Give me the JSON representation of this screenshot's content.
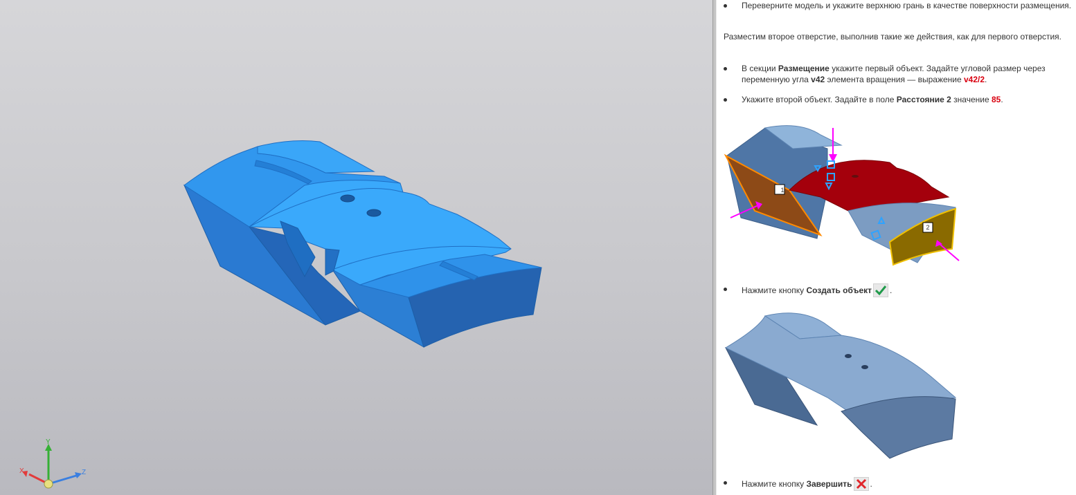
{
  "help": {
    "item1": "Переверните модель и укажите верхнюю грань в качестве поверхности размещения.",
    "para1": "Разместим второе отверстие, выполнив такие же действия, как для первого отверстия.",
    "item2": {
      "p1": "В секции ",
      "b1": "Размещение",
      "p2": " укажите первый объект. Задайте угловой размер через переменную угла ",
      "b2": "v42",
      "p3": " элемента вращения — выражение ",
      "r1": "v42/2",
      "p4": "."
    },
    "item3": {
      "p1": "Укажите второй объект. Задайте в поле ",
      "b1": "Расстояние 2",
      "p2": " значение ",
      "r1": "85",
      "p3": "."
    },
    "item4": {
      "p1": "Нажмите кнопку ",
      "b1": "Создать объект",
      "p2": "."
    },
    "item5": {
      "p1": "Нажмите кнопку ",
      "b1": "Завершить",
      "p2": "."
    },
    "callout1": "1",
    "callout2": "2"
  },
  "triad": {
    "x_label": "X",
    "y_label": "Y",
    "z_label": "Z"
  },
  "colors": {
    "model_light": "#35a3f6",
    "model_side": "#2679cf",
    "selected_face": "#a4000c",
    "face1": "#8d4a17",
    "face2": "#8a6a00",
    "arrow": "#ff00ff"
  },
  "icons": {
    "create": "checkmark-icon",
    "finish": "cross-icon"
  }
}
